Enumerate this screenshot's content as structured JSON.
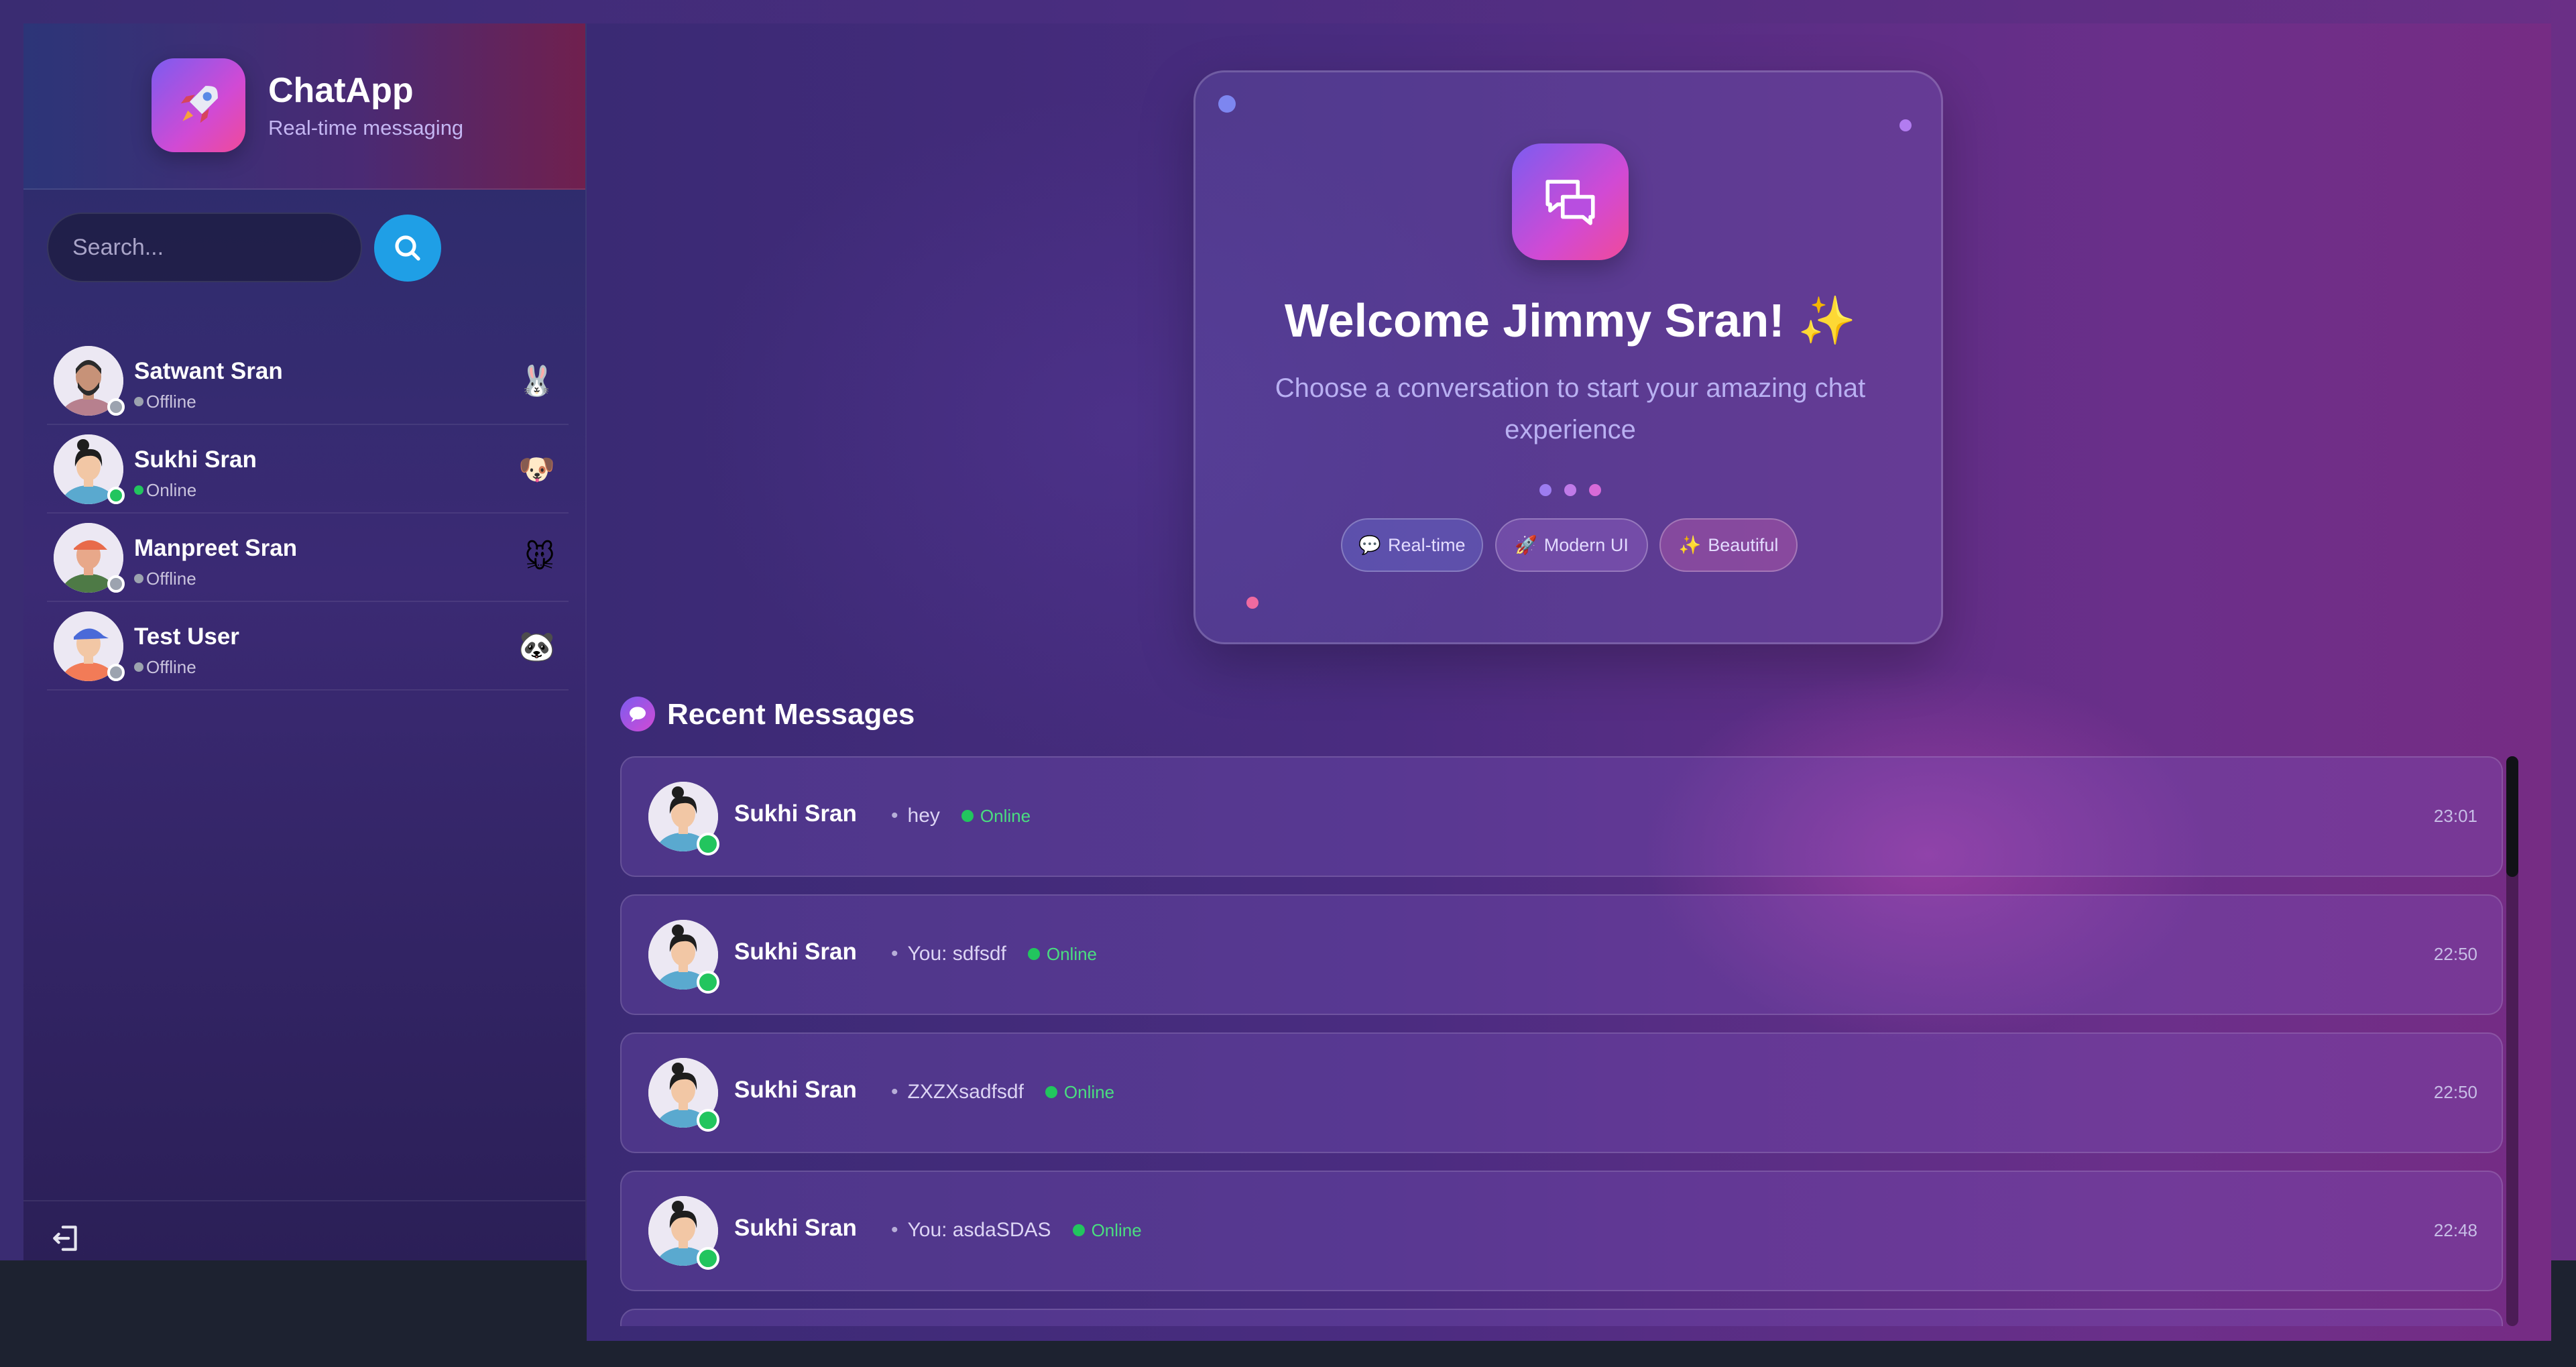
{
  "app": {
    "title": "ChatApp",
    "subtitle": "Real-time messaging",
    "logo_icon": "rocket-icon"
  },
  "search": {
    "placeholder": "Search...",
    "button_icon": "search-icon",
    "accent": "#1f9fe6"
  },
  "users": [
    {
      "name": "Satwant Sran",
      "status": "Offline",
      "emoji": "🐰",
      "online": false
    },
    {
      "name": "Sukhi Sran",
      "status": "Online",
      "emoji": "🐶",
      "online": true
    },
    {
      "name": "Manpreet Sran",
      "status": "Offline",
      "emoji": "🐭",
      "online": false
    },
    {
      "name": "Test User",
      "status": "Offline",
      "emoji": "🐼",
      "online": false
    }
  ],
  "footer": {
    "logout_icon": "logout-icon"
  },
  "welcome": {
    "icon": "chat-bubbles-icon",
    "title": "Welcome Jimmy Sran! ✨",
    "subtitle": "Choose a conversation to start your amazing chat experience",
    "chips": [
      {
        "icon": "💬",
        "label": "Real-time"
      },
      {
        "icon": "🚀",
        "label": "Modern UI"
      },
      {
        "icon": "✨",
        "label": "Beautiful"
      }
    ]
  },
  "recent": {
    "title": "Recent Messages",
    "icon": "speech-bubble-icon",
    "messages": [
      {
        "name": "Sukhi Sran",
        "sep": "•",
        "preview": "hey",
        "status": "Online",
        "time": "23:01"
      },
      {
        "name": "Sukhi Sran",
        "sep": "•",
        "preview": "You: sdfsdf",
        "status": "Online",
        "time": "22:50"
      },
      {
        "name": "Sukhi Sran",
        "sep": "•",
        "preview": "ZXZXsadfsdf",
        "status": "Online",
        "time": "22:50"
      },
      {
        "name": "Sukhi Sran",
        "sep": "•",
        "preview": "You: asdaSDAS",
        "status": "Online",
        "time": "22:48"
      }
    ]
  },
  "colors": {
    "online": "#22c55e",
    "offline": "#9ca3af",
    "gradient_start": "#7c5cf0",
    "gradient_end": "#f04a9a"
  }
}
